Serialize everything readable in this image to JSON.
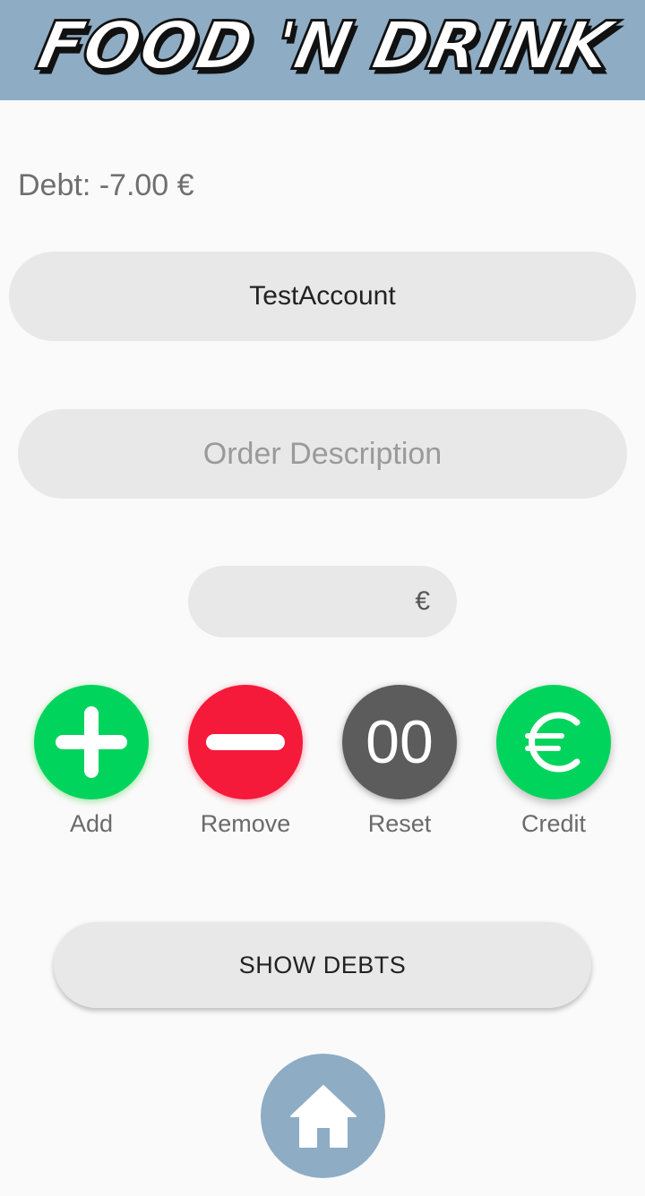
{
  "app": {
    "title": "FOOD 'N DRINK",
    "colors": {
      "header": "#8eacc4",
      "add": "#00d45c",
      "remove": "#f5193a",
      "reset": "#5c5c5c",
      "credit": "#00d45c"
    }
  },
  "debt": {
    "text": "Debt: -7.00 €"
  },
  "account": {
    "name": "TestAccount"
  },
  "order": {
    "placeholder": "Order Description"
  },
  "amount": {
    "currency_symbol": "€",
    "value": ""
  },
  "actions": [
    {
      "label": "Add",
      "icon": "plus-icon"
    },
    {
      "label": "Remove",
      "icon": "minus-icon"
    },
    {
      "label": "Reset",
      "icon": "reset-icon",
      "icon_text": "00"
    },
    {
      "label": "Credit",
      "icon": "euro-icon"
    }
  ],
  "show_debts": {
    "label": "SHOW DEBTS"
  },
  "nav": {
    "home_icon": "home-icon"
  }
}
